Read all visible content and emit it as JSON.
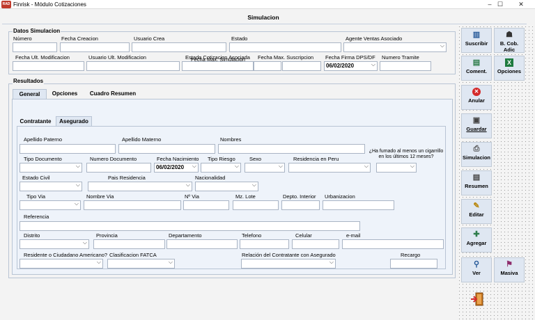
{
  "window": {
    "title": "Finrisk - Módulo Cotizaciones",
    "icon_text": "RAD"
  },
  "caption": "Simulacion",
  "datos": {
    "header": "Datos Simulacion",
    "labels": {
      "numero": "Número",
      "fecha_creacion": "Fecha Creacion",
      "usuario_crea": "Usuario Crea",
      "estado": "Estado",
      "agente": "Agente Ventas Asociado",
      "fecha_ult_mod": "Fecha Ult. Modificacion",
      "usuario_ult_mod": "Usuario Ult. Modificacion",
      "estado_cot": "Estado Cotizacion Asociada",
      "fecha_max_sim": "Fecha Max. Simulacion",
      "fecha_max_sus": "Fecha Max. Suscripcion",
      "fecha_firma": "Fecha Firma DPS/DF",
      "numero_tramite": "Numero Tramite"
    },
    "values": {
      "fecha_firma": "06/02/2020"
    }
  },
  "resultados": {
    "header": "Resultados",
    "tabs": [
      "General",
      "Opciones",
      "Cuadro Resumen"
    ],
    "subtabs": [
      "Contratante",
      "Asegurado"
    ]
  },
  "asegurado": {
    "labels": {
      "apellido_paterno": "Apellido Paterno",
      "apellido_materno": "Apellido Materno",
      "nombres": "Nombres",
      "fumado": "¿Ha fumado al menos un cigarrillo en los últimos 12 meses?",
      "tipo_documento": "Tipo Documento",
      "numero_documento": "Numero Documento",
      "fecha_nacimiento": "Fecha Nacimiento",
      "tipo_riesgo": "Tipo Riesgo",
      "sexo": "Sexo",
      "residencia": "Residencia en Peru",
      "estado_civil": "Estado Civil",
      "pais_residencia": "Pais Residencia",
      "nacionalidad": "Nacionalidad",
      "tipo_via": "Tipo Via",
      "nombre_via": "Nombre Via",
      "nro_via": "Nº Via",
      "mz_lote": "Mz. Lote",
      "depto": "Depto. Interior",
      "urbanizacion": "Urbanizacion",
      "referencia": "Referencia",
      "distrito": "Distrito",
      "provincia": "Provincia",
      "departamento": "Departamento",
      "telefono": "Telefono",
      "celular": "Celular",
      "email": "e-mail",
      "residente_usa": "Residente o Ciudadano Americano?",
      "fatca": "Clasificacion FATCA",
      "relacion": "Relación del Contratante con Asegurado",
      "recargo": "Recargo"
    },
    "values": {
      "fecha_nacimiento": "06/02/2020"
    }
  },
  "buttons": {
    "suscribir": "Suscribir",
    "b_cob": "B. Cob. Adic",
    "coment": "Coment.",
    "opciones": "Opciones",
    "anular": "Anular",
    "guardar": "Guardar",
    "simulacion": "Simulacion",
    "resumen": "Resumen",
    "editar": "Editar",
    "agregar": "Agregar",
    "ver": "Ver",
    "masiva": "Masiva"
  },
  "colors": {
    "excel": "#1e7b3f",
    "anular": "#d42a2a",
    "accent_bg": "#dfe7f2"
  }
}
